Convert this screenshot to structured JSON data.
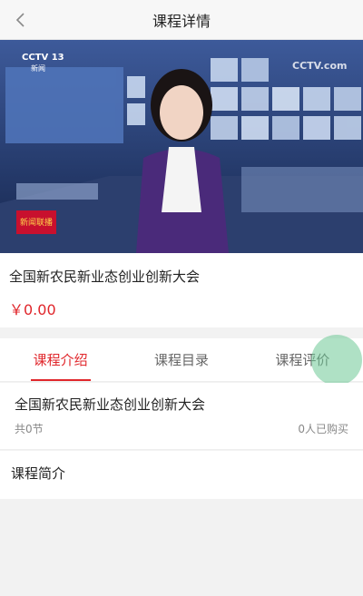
{
  "navbar": {
    "title": "课程详情"
  },
  "video": {
    "channel_logo": "CCTV 13",
    "channel_sub": "新闻",
    "watermark": "CCTV.com",
    "program_badge": "新闻联播"
  },
  "course": {
    "title": "全国新农民新业态创业创新大会",
    "price": "￥0.00"
  },
  "tabs": [
    {
      "label": "课程介绍",
      "active": true
    },
    {
      "label": "课程目录",
      "active": false
    },
    {
      "label": "课程评价",
      "active": false
    }
  ],
  "summary": {
    "title": "全国新农民新业态创业创新大会",
    "lessons": "共0节",
    "buyers": "0人已购买"
  },
  "intro": {
    "title": "课程简介"
  },
  "colors": {
    "accent": "#e0262b",
    "navbar_bg": "#f7f7f7",
    "page_bg": "#f2f2f2"
  }
}
